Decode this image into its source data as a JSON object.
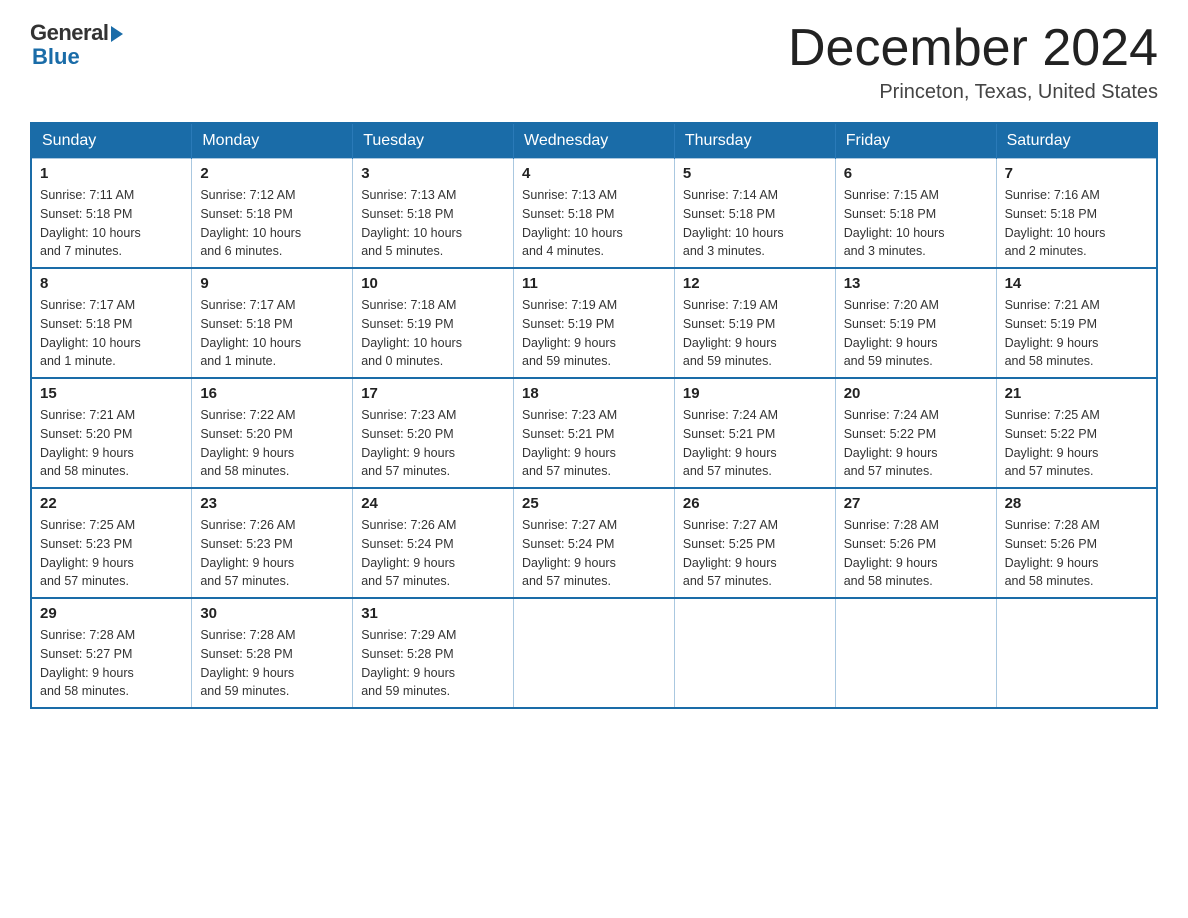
{
  "header": {
    "logo_general": "General",
    "logo_blue": "Blue",
    "title": "December 2024",
    "location": "Princeton, Texas, United States"
  },
  "days_of_week": [
    "Sunday",
    "Monday",
    "Tuesday",
    "Wednesday",
    "Thursday",
    "Friday",
    "Saturday"
  ],
  "weeks": [
    [
      {
        "day": "1",
        "sunrise": "7:11 AM",
        "sunset": "5:18 PM",
        "daylight": "10 hours and 7 minutes."
      },
      {
        "day": "2",
        "sunrise": "7:12 AM",
        "sunset": "5:18 PM",
        "daylight": "10 hours and 6 minutes."
      },
      {
        "day": "3",
        "sunrise": "7:13 AM",
        "sunset": "5:18 PM",
        "daylight": "10 hours and 5 minutes."
      },
      {
        "day": "4",
        "sunrise": "7:13 AM",
        "sunset": "5:18 PM",
        "daylight": "10 hours and 4 minutes."
      },
      {
        "day": "5",
        "sunrise": "7:14 AM",
        "sunset": "5:18 PM",
        "daylight": "10 hours and 3 minutes."
      },
      {
        "day": "6",
        "sunrise": "7:15 AM",
        "sunset": "5:18 PM",
        "daylight": "10 hours and 3 minutes."
      },
      {
        "day": "7",
        "sunrise": "7:16 AM",
        "sunset": "5:18 PM",
        "daylight": "10 hours and 2 minutes."
      }
    ],
    [
      {
        "day": "8",
        "sunrise": "7:17 AM",
        "sunset": "5:18 PM",
        "daylight": "10 hours and 1 minute."
      },
      {
        "day": "9",
        "sunrise": "7:17 AM",
        "sunset": "5:18 PM",
        "daylight": "10 hours and 1 minute."
      },
      {
        "day": "10",
        "sunrise": "7:18 AM",
        "sunset": "5:19 PM",
        "daylight": "10 hours and 0 minutes."
      },
      {
        "day": "11",
        "sunrise": "7:19 AM",
        "sunset": "5:19 PM",
        "daylight": "9 hours and 59 minutes."
      },
      {
        "day": "12",
        "sunrise": "7:19 AM",
        "sunset": "5:19 PM",
        "daylight": "9 hours and 59 minutes."
      },
      {
        "day": "13",
        "sunrise": "7:20 AM",
        "sunset": "5:19 PM",
        "daylight": "9 hours and 59 minutes."
      },
      {
        "day": "14",
        "sunrise": "7:21 AM",
        "sunset": "5:19 PM",
        "daylight": "9 hours and 58 minutes."
      }
    ],
    [
      {
        "day": "15",
        "sunrise": "7:21 AM",
        "sunset": "5:20 PM",
        "daylight": "9 hours and 58 minutes."
      },
      {
        "day": "16",
        "sunrise": "7:22 AM",
        "sunset": "5:20 PM",
        "daylight": "9 hours and 58 minutes."
      },
      {
        "day": "17",
        "sunrise": "7:23 AM",
        "sunset": "5:20 PM",
        "daylight": "9 hours and 57 minutes."
      },
      {
        "day": "18",
        "sunrise": "7:23 AM",
        "sunset": "5:21 PM",
        "daylight": "9 hours and 57 minutes."
      },
      {
        "day": "19",
        "sunrise": "7:24 AM",
        "sunset": "5:21 PM",
        "daylight": "9 hours and 57 minutes."
      },
      {
        "day": "20",
        "sunrise": "7:24 AM",
        "sunset": "5:22 PM",
        "daylight": "9 hours and 57 minutes."
      },
      {
        "day": "21",
        "sunrise": "7:25 AM",
        "sunset": "5:22 PM",
        "daylight": "9 hours and 57 minutes."
      }
    ],
    [
      {
        "day": "22",
        "sunrise": "7:25 AM",
        "sunset": "5:23 PM",
        "daylight": "9 hours and 57 minutes."
      },
      {
        "day": "23",
        "sunrise": "7:26 AM",
        "sunset": "5:23 PM",
        "daylight": "9 hours and 57 minutes."
      },
      {
        "day": "24",
        "sunrise": "7:26 AM",
        "sunset": "5:24 PM",
        "daylight": "9 hours and 57 minutes."
      },
      {
        "day": "25",
        "sunrise": "7:27 AM",
        "sunset": "5:24 PM",
        "daylight": "9 hours and 57 minutes."
      },
      {
        "day": "26",
        "sunrise": "7:27 AM",
        "sunset": "5:25 PM",
        "daylight": "9 hours and 57 minutes."
      },
      {
        "day": "27",
        "sunrise": "7:28 AM",
        "sunset": "5:26 PM",
        "daylight": "9 hours and 58 minutes."
      },
      {
        "day": "28",
        "sunrise": "7:28 AM",
        "sunset": "5:26 PM",
        "daylight": "9 hours and 58 minutes."
      }
    ],
    [
      {
        "day": "29",
        "sunrise": "7:28 AM",
        "sunset": "5:27 PM",
        "daylight": "9 hours and 58 minutes."
      },
      {
        "day": "30",
        "sunrise": "7:28 AM",
        "sunset": "5:28 PM",
        "daylight": "9 hours and 59 minutes."
      },
      {
        "day": "31",
        "sunrise": "7:29 AM",
        "sunset": "5:28 PM",
        "daylight": "9 hours and 59 minutes."
      },
      null,
      null,
      null,
      null
    ]
  ],
  "labels": {
    "sunrise": "Sunrise:",
    "sunset": "Sunset:",
    "daylight": "Daylight:"
  }
}
